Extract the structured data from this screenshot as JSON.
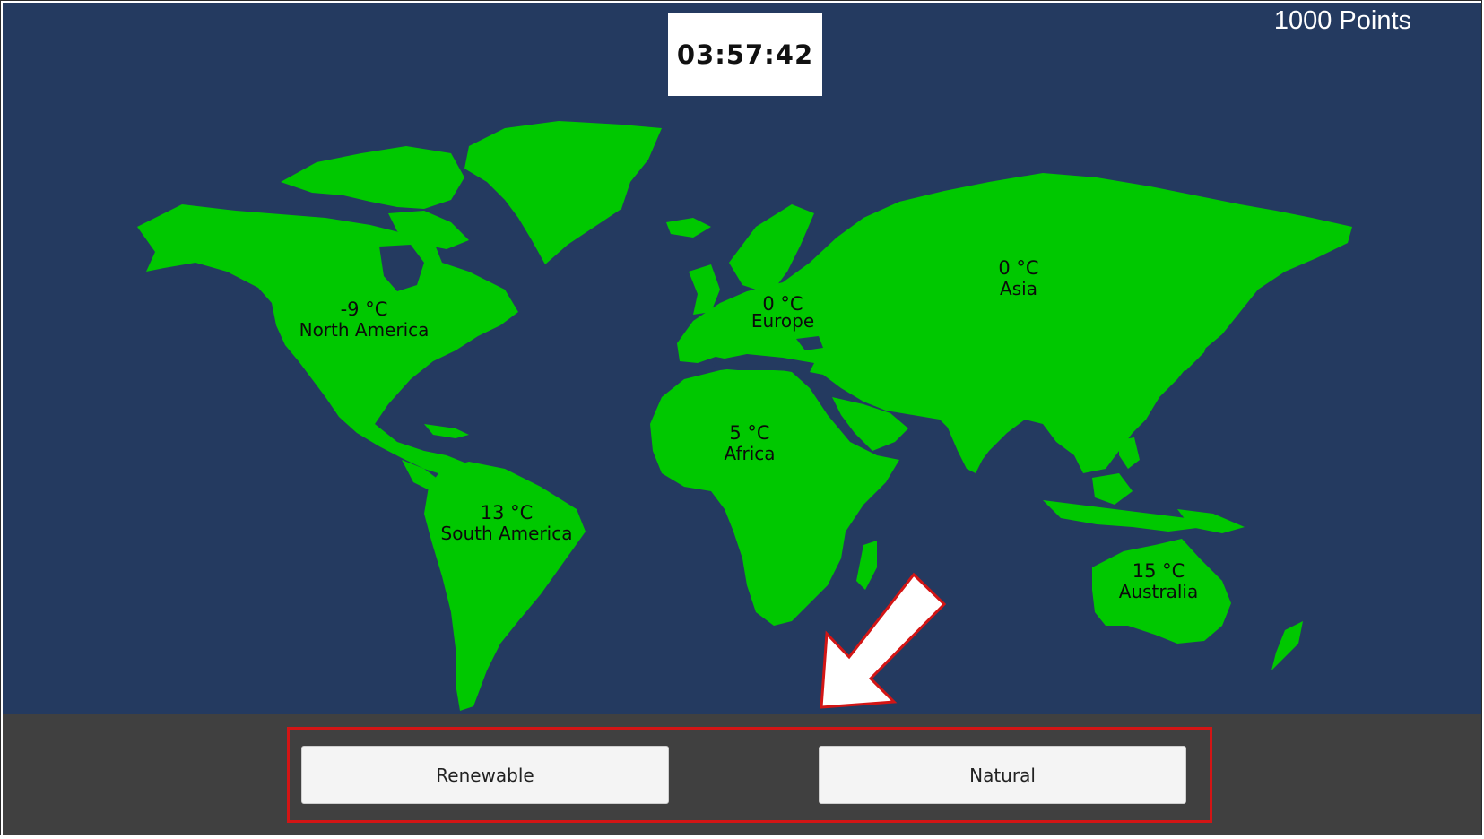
{
  "hud": {
    "timer": "03:57:42",
    "points": "1000 Points"
  },
  "regions": {
    "north_america": {
      "temp": "-9 °C",
      "name": "North America"
    },
    "south_america": {
      "temp": "13 °C",
      "name": "South America"
    },
    "europe": {
      "temp": "0 °C",
      "name": "Europe"
    },
    "africa": {
      "temp": "5 °C",
      "name": "Africa"
    },
    "asia": {
      "temp": "0 °C",
      "name": "Asia"
    },
    "australia": {
      "temp": "15 °C",
      "name": "Australia"
    }
  },
  "buttons": {
    "renewable": "Renewable",
    "natural": "Natural"
  },
  "colors": {
    "ocean": "#243a60",
    "land": "#00c800",
    "bottom_bar": "#404040",
    "highlight": "#d31515"
  }
}
